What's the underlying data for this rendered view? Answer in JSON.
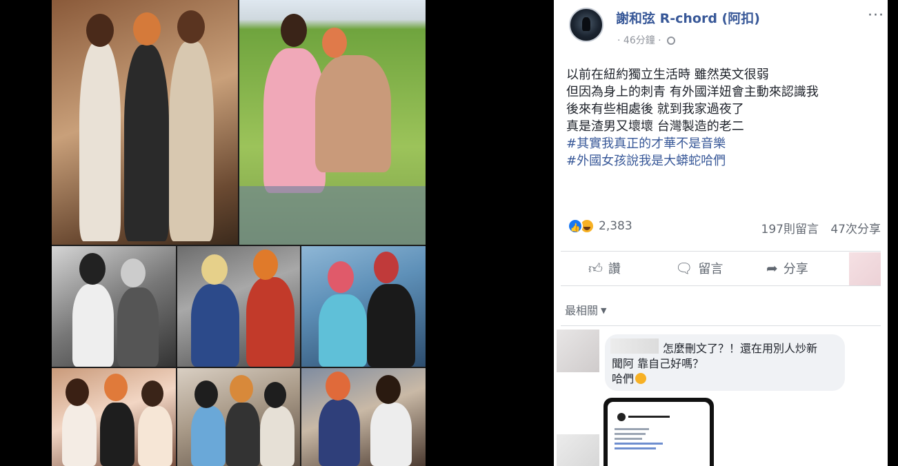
{
  "post": {
    "author": "謝和弦 R-chord (阿扣)",
    "time": "46分鐘",
    "more": "···",
    "lines": [
      "以前在紐約獨立生活時 雖然英文很弱",
      "但因為身上的刺青 有外國洋妞會主動來認識我",
      "後來有些相處後 就到我家過夜了",
      "真是渣男又壞壞 台灣製造的老二"
    ],
    "hashtags": [
      "#其實我真正的才華不是音樂",
      "#外國女孩說我是大蟒蛇哈們"
    ],
    "reaction_count": "2,383",
    "comment_count": "197則留言",
    "share_count": "47次分享",
    "actions": {
      "like": "讚",
      "comment": "留言",
      "share": "分享"
    },
    "sort_label": "最相關",
    "comment": {
      "line1": "怎麼刪文了？！還在用別人炒新",
      "line2": "聞阿 靠自己好嗎？",
      "line3": "哈們"
    }
  },
  "icons": {
    "like": "thumb-up-icon",
    "comment": "speech-bubble-icon",
    "share": "share-arrow-icon",
    "privacy": "globe-icon"
  },
  "colors": {
    "link": "#385898",
    "like_blue": "#1877f2",
    "haha_yellow": "#f7b125",
    "secondary_text": "#606770"
  }
}
